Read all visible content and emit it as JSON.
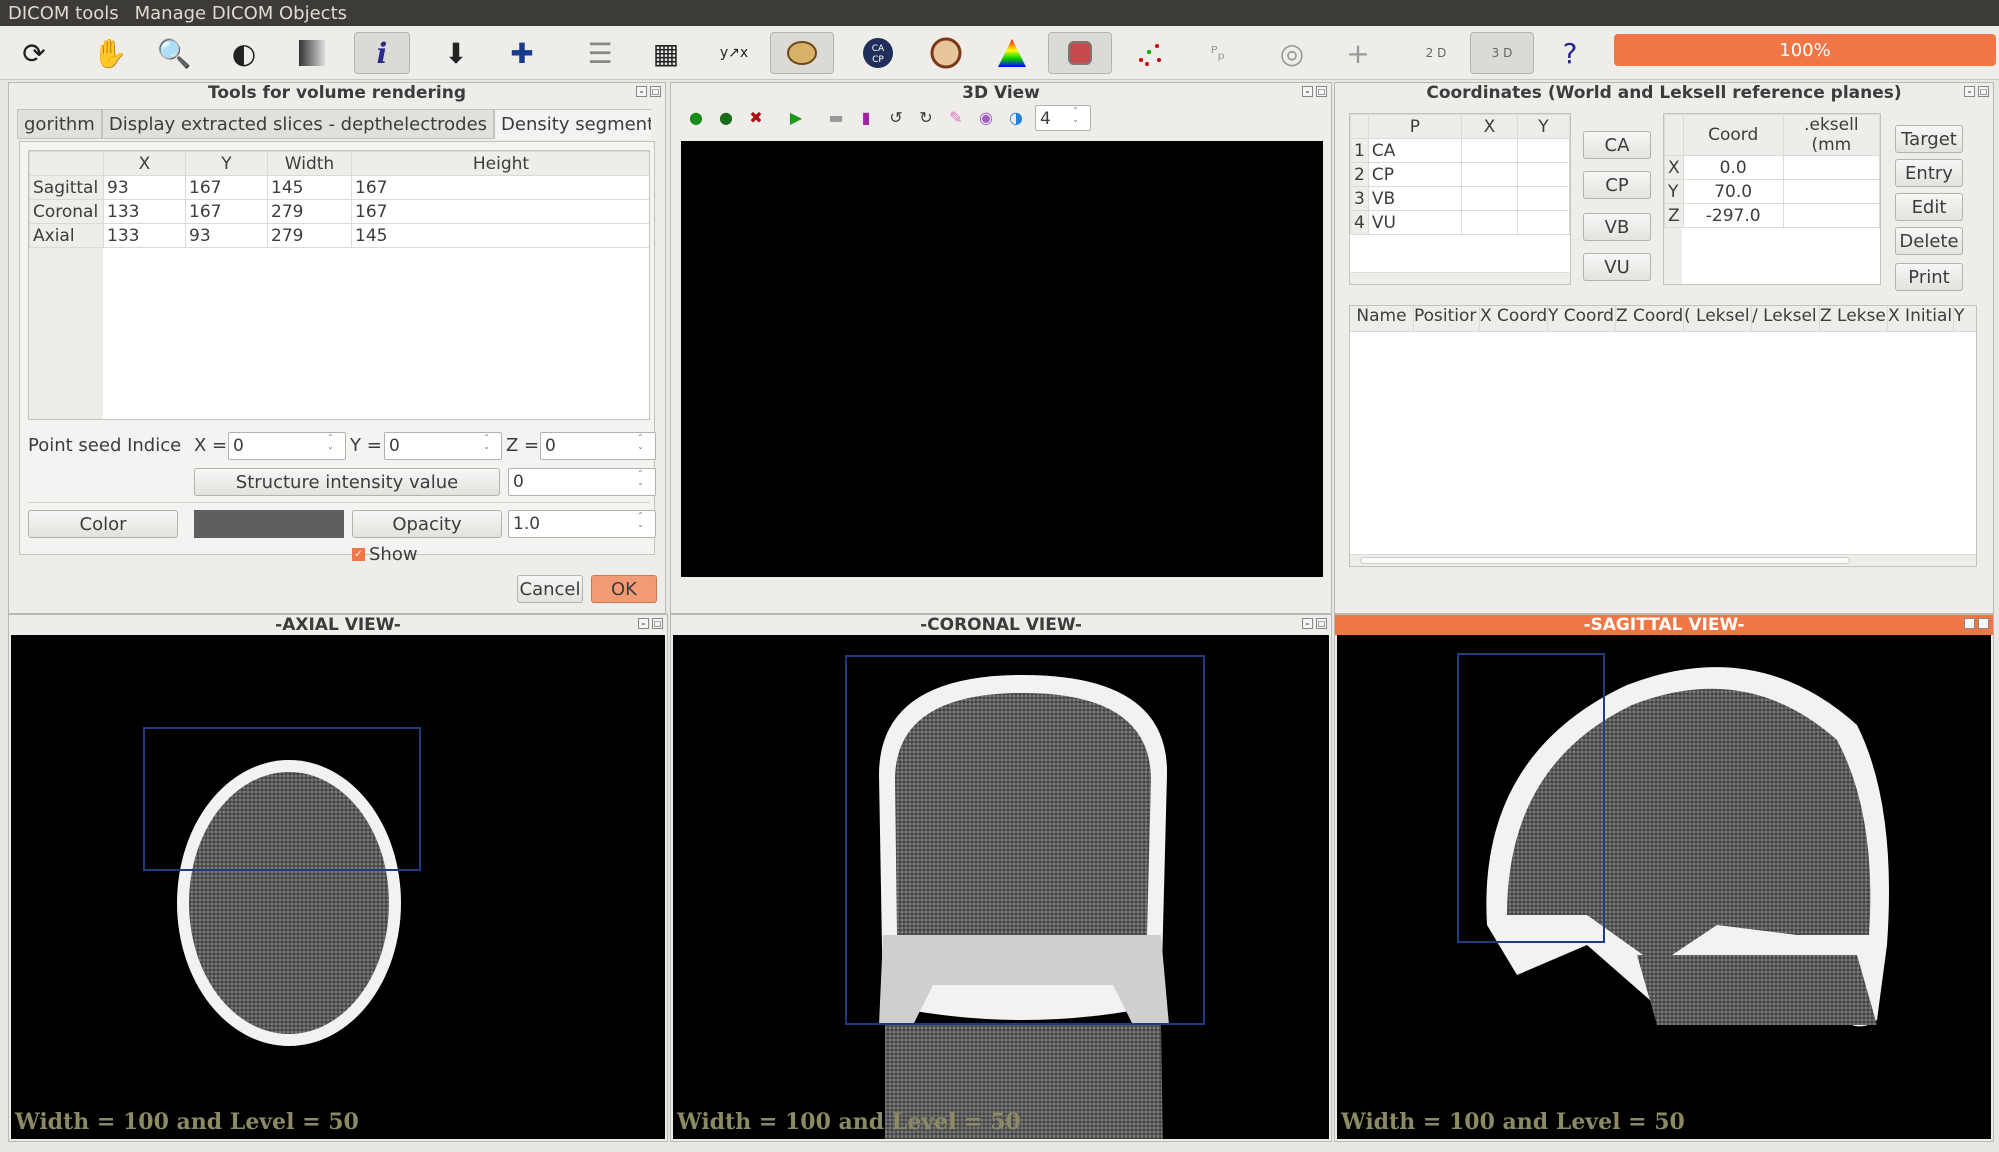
{
  "menu": [
    "DICOM tools",
    "Manage DICOM Objects"
  ],
  "toolbar": {
    "icons": [
      "refresh-icon",
      "hand-icon",
      "zoom-icon",
      "contrast-icon",
      "brightness-icon",
      "info-icon",
      "probe-icon",
      "crosshair-icon",
      "slices-icon",
      "layout-icon",
      "axes-icon",
      "brain-icon",
      "ca-cp-icon",
      "head-icon",
      "color-map-icon",
      "mask-icon",
      "points-icon",
      "pp-icon",
      "rings-icon",
      "plus-icon",
      "2d-icon",
      "3d-icon",
      "help-icon"
    ],
    "progress": "100%"
  },
  "tools_panel": {
    "title": "Tools for volume rendering",
    "tabs": [
      "gorithm",
      "Display extracted slices - depthelectrodes",
      "Density segmentation"
    ],
    "table": {
      "headers": [
        "",
        "X",
        "Y",
        "Width",
        "Height"
      ],
      "rows": [
        [
          "Sagittal",
          "93",
          "167",
          "145",
          "167"
        ],
        [
          "Coronal",
          "133",
          "167",
          "279",
          "167"
        ],
        [
          "Axial",
          "133",
          "93",
          "279",
          "145"
        ]
      ]
    },
    "seed_label": "Point seed Indice",
    "x_label": "X =",
    "x_value": "0",
    "y_label": "Y =",
    "y_value": "0",
    "z_label": "Z =",
    "z_value": "0",
    "structure_button": "Structure intensity value",
    "structure_value": "0",
    "color_button": "Color",
    "swatch_color": "#5e5e5e",
    "opacity_button": "Opacity",
    "opacity_value": "1.0",
    "show_label": "Show",
    "cancel": "Cancel",
    "ok": "OK"
  },
  "view3d": {
    "title": "3D View",
    "spin_value": "4"
  },
  "coords_panel": {
    "title": "Coordinates (World and Leksell reference planes)",
    "points_headers": [
      "",
      "P",
      "X",
      "Y"
    ],
    "points": [
      [
        "1",
        "CA"
      ],
      [
        "2",
        "CP"
      ],
      [
        "3",
        "VB"
      ],
      [
        "4",
        "VU"
      ]
    ],
    "point_buttons": [
      "CA",
      "CP",
      "VB",
      "VU"
    ],
    "coord_headers": [
      "",
      "Coord",
      ".eksell (mm"
    ],
    "coords": [
      [
        "X",
        "0.0"
      ],
      [
        "Y",
        "70.0"
      ],
      [
        "Z",
        "-297.0"
      ]
    ],
    "action_buttons": [
      "Target",
      "Entry",
      "Edit",
      "Delete",
      "Print"
    ],
    "targets_headers": [
      "Name",
      "Positior",
      "X Coord",
      "Y Coord",
      "Z Coord",
      "( Leksel",
      "/ Leksel",
      "Z Leksel",
      "X Initial",
      "Y"
    ]
  },
  "views": {
    "axial_title": "-AXIAL VIEW-",
    "coronal_title": "-CORONAL VIEW-",
    "sagittal_title": "-SAGITTAL VIEW-",
    "wl_text": "Width = 100 and Level =  50"
  },
  "colors": {
    "accent": "#f07646",
    "roi": "#1e3c82"
  }
}
